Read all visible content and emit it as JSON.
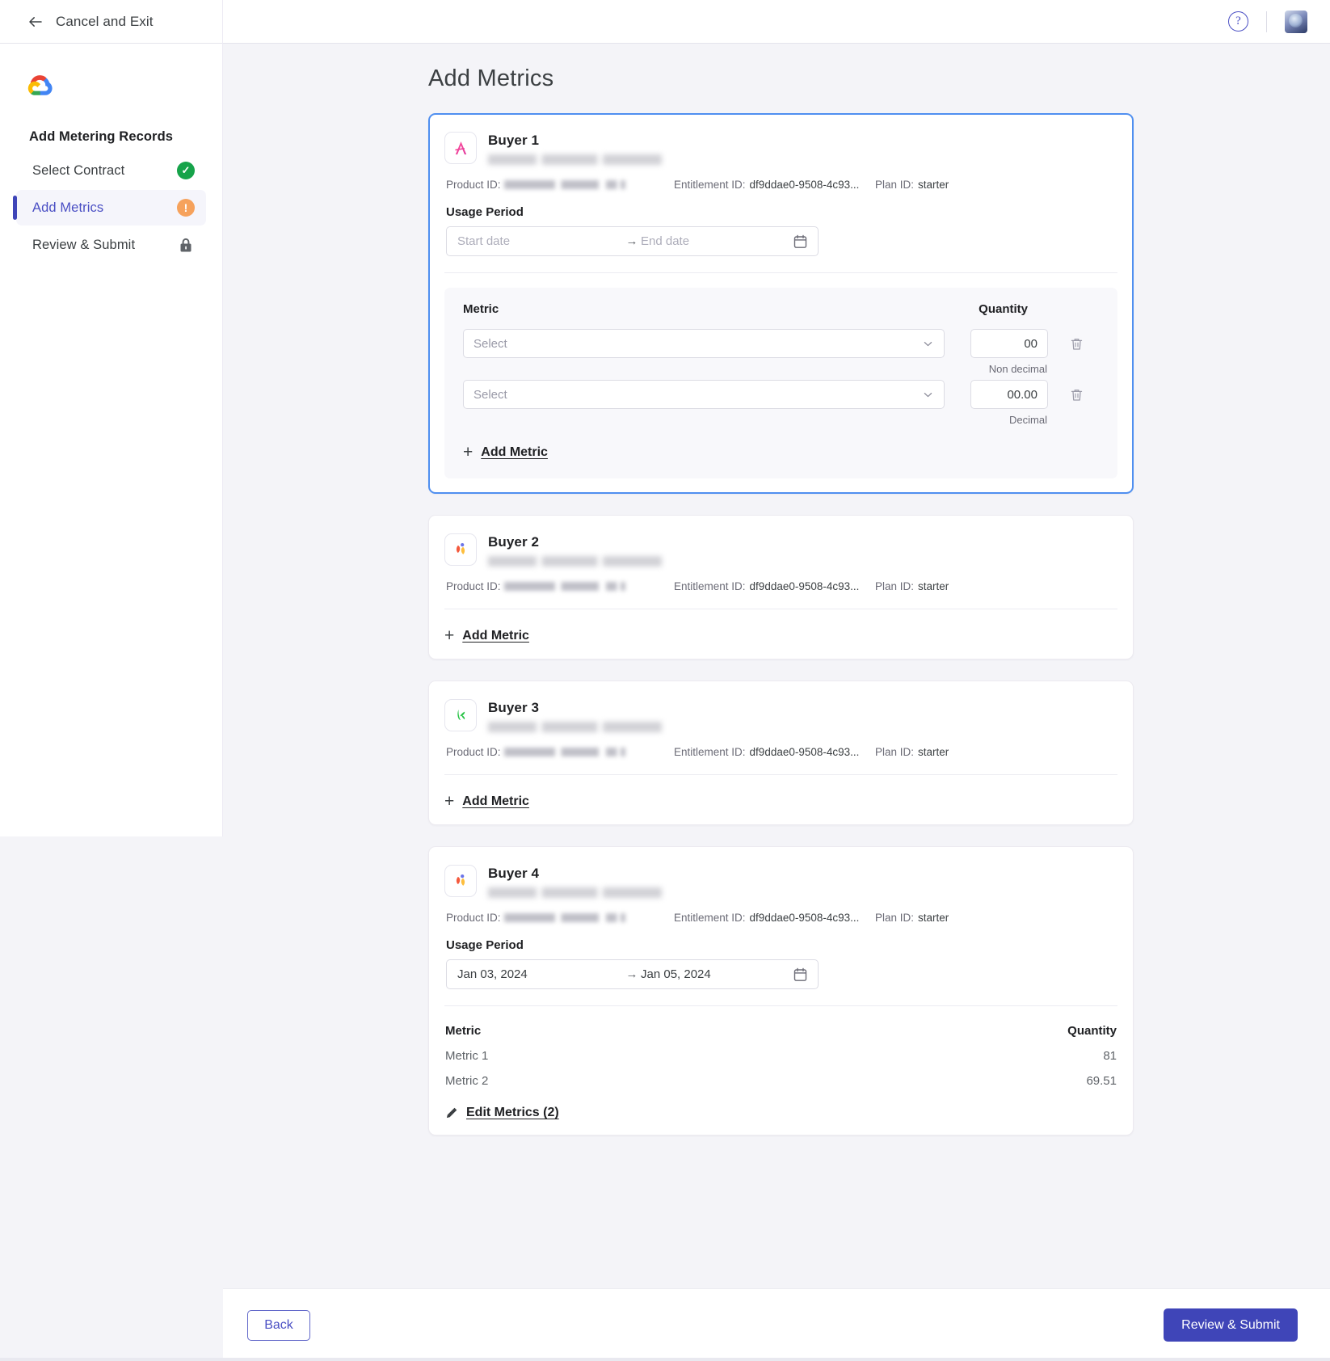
{
  "topbar": {
    "cancel_exit_label": "Cancel and Exit",
    "back_arrow_icon": "arrow-left-icon",
    "help_icon": "help-circle-icon",
    "help_glyph": "?",
    "avatar_icon": "user-avatar"
  },
  "sidebar": {
    "logo_icon": "google-cloud-logo",
    "title": "Add Metering Records",
    "items": [
      {
        "label": "Select Contract",
        "status": "complete",
        "status_icon": "check-circle-icon",
        "status_glyph": "✓",
        "active": false
      },
      {
        "label": "Add Metrics",
        "status": "warning",
        "status_icon": "alert-circle-icon",
        "status_glyph": "!",
        "active": true
      },
      {
        "label": "Review & Submit",
        "status": "locked",
        "status_icon": "lock-icon",
        "status_glyph": "",
        "active": false
      }
    ]
  },
  "main": {
    "page_title": "Add Metrics",
    "labels": {
      "product_id": "Product ID:",
      "entitlement_id": "Entitlement ID:",
      "plan_id": "Plan ID:",
      "usage_period": "Usage Period",
      "metric_col": "Metric",
      "quantity_col": "Quantity",
      "select_placeholder": "Select",
      "start_date_placeholder": "Start date",
      "end_date_placeholder": "End date",
      "date_arrow": "→",
      "add_metric": "Add Metric",
      "plus_glyph": "+",
      "calendar_icon": "calendar-icon",
      "chevron_down_icon": "chevron-down-icon",
      "delete_icon": "trash-icon",
      "edit_icon": "pencil-icon"
    },
    "buyers": [
      {
        "name": "Buyer 1",
        "logo_icon": "buyer-logo-a-mark",
        "entitlement_id": "df9ddae0-9508-4c93...",
        "plan_id": "starter",
        "selected": true,
        "usage_period": {
          "start": "",
          "end": ""
        },
        "metric_rows": [
          {
            "metric": "",
            "quantity": "00",
            "hint": "Non decimal"
          },
          {
            "metric": "",
            "quantity": "00.00",
            "hint": "Decimal"
          }
        ]
      },
      {
        "name": "Buyer 2",
        "logo_icon": "buyer-logo-tulip-mark",
        "entitlement_id": "df9ddae0-9508-4c93...",
        "plan_id": "starter",
        "selected": false
      },
      {
        "name": "Buyer 3",
        "logo_icon": "buyer-logo-green-leaf-mark",
        "entitlement_id": "df9ddae0-9508-4c93...",
        "plan_id": "starter",
        "selected": false
      },
      {
        "name": "Buyer 4",
        "logo_icon": "buyer-logo-tulip-mark",
        "entitlement_id": "df9ddae0-9508-4c93...",
        "plan_id": "starter",
        "selected": false,
        "usage_period": {
          "start": "Jan 03, 2024",
          "end": "Jan 05, 2024"
        },
        "metrics_table": {
          "columns": [
            "Metric",
            "Quantity"
          ],
          "rows": [
            {
              "metric": "Metric 1",
              "quantity": "81"
            },
            {
              "metric": "Metric 2",
              "quantity": "69.51"
            }
          ]
        },
        "edit_metrics_label": "Edit Metrics (2)"
      }
    ]
  },
  "footer": {
    "back_label": "Back",
    "submit_label": "Review & Submit"
  },
  "colors": {
    "accent": "#3f45b8",
    "accent_text": "#4a4fc4",
    "success": "#16a34a",
    "warning": "#f6a25c",
    "selected_border": "#4f8ff0",
    "page_bg": "#f4f4f8"
  }
}
